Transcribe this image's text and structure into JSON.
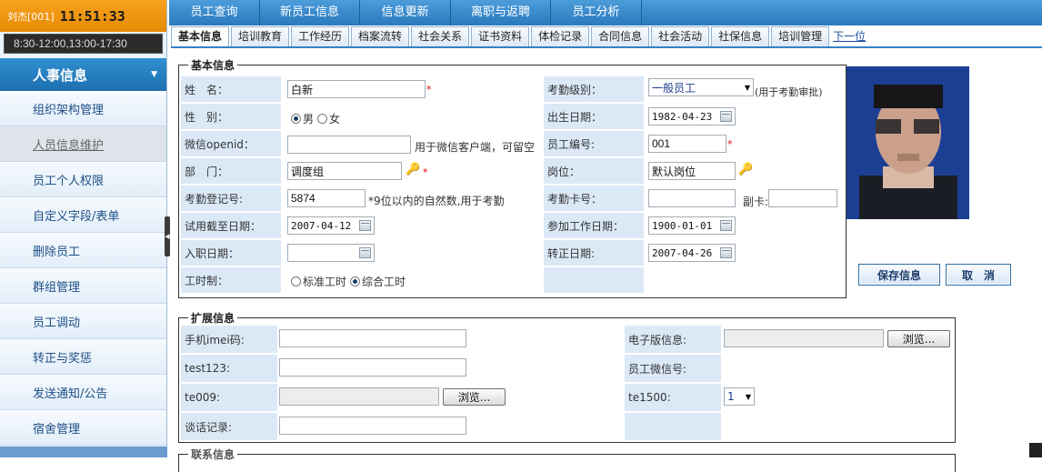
{
  "user": {
    "name": "刘杰[001]",
    "clock": "11:51:33",
    "hours": "8:30-12:00,13:00-17:30"
  },
  "sidebar": {
    "header": "人事信息",
    "items": [
      {
        "label": "组织架构管理"
      },
      {
        "label": "人员信息维护"
      },
      {
        "label": "员工个人权限"
      },
      {
        "label": "自定义字段/表单"
      },
      {
        "label": "删除员工"
      },
      {
        "label": "群组管理"
      },
      {
        "label": "员工调动"
      },
      {
        "label": "转正与奖惩"
      },
      {
        "label": "发送通知/公告"
      },
      {
        "label": "宿舍管理"
      }
    ]
  },
  "topnav": [
    "员工查询",
    "新员工信息",
    "信息更新",
    "离职与返聘",
    "员工分析"
  ],
  "subtabs": {
    "tabs": [
      "基本信息",
      "培训教育",
      "工作经历",
      "档案流转",
      "社会关系",
      "证书资料",
      "体检记录",
      "合同信息",
      "社会活动",
      "社保信息",
      "培训管理"
    ],
    "next": "下一位"
  },
  "basic": {
    "legend": "基本信息",
    "name": {
      "label": "姓　名：",
      "value": "白新"
    },
    "gender": {
      "label": "性　别：",
      "male": "男",
      "female": "女"
    },
    "wechat": {
      "label": "微信openid：",
      "value": "",
      "note": "用于微信客户端，可留空"
    },
    "dept": {
      "label": "部　门：",
      "value": "调度组"
    },
    "attendance_no": {
      "label": "考勤登记号:",
      "value": "5874",
      "note": "*9位以内的自然数,用于考勤"
    },
    "probation_end": {
      "label": "试用截至日期：",
      "value": "2007-04-12"
    },
    "entry_date": {
      "label": "入职日期：",
      "value": ""
    },
    "work_hours": {
      "label": "工时制：",
      "standard": "标准工时",
      "combined": "综合工时"
    },
    "attendance_level": {
      "label": "考勤级别：",
      "value": "一般员工",
      "note": "(用于考勤审批)"
    },
    "birth": {
      "label": "出生日期：",
      "value": "1982-04-23"
    },
    "emp_no": {
      "label": "员工编号:",
      "value": "001"
    },
    "position": {
      "label": "岗位：",
      "value": "默认岗位"
    },
    "card_no": {
      "label": "考勤卡号：",
      "value": "",
      "sub_label": "副卡:",
      "sub_value": ""
    },
    "work_start": {
      "label": "参加工作日期：",
      "value": "1900-01-01"
    },
    "regular_date": {
      "label": "转正日期:",
      "value": "2007-04-26"
    }
  },
  "actions": {
    "save": "保存信息",
    "cancel": "取　消"
  },
  "extended": {
    "legend": "扩展信息",
    "imei": {
      "label": "手机imei码:",
      "value": ""
    },
    "test123": {
      "label": "test123:",
      "value": ""
    },
    "te009": {
      "label": "te009:",
      "value": "",
      "browse": "浏览..."
    },
    "talk": {
      "label": "谈话记录:",
      "value": ""
    },
    "e_doc": {
      "label": "电子版信息:",
      "value": "",
      "browse": "浏览..."
    },
    "wechat_id": {
      "label": "员工微信号:"
    },
    "te1500": {
      "label": "te1500:",
      "value": "1"
    }
  },
  "contact": {
    "legend": "联系信息"
  }
}
